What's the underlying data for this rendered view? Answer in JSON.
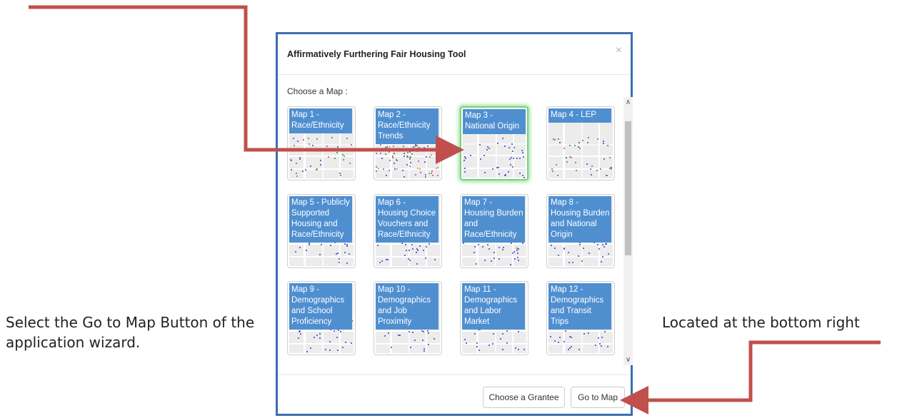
{
  "annotations": {
    "left": "Select the Go to Map Button of the application wizard.",
    "right": "Located at the bottom right"
  },
  "colors": {
    "modal_border": "#3b6fb0",
    "tile_label_bg": "#4f8fd0",
    "selected_glow": "#7cd17c",
    "arrow": "#c0504d"
  },
  "modal": {
    "title": "Affirmatively Furthering Fair Housing Tool",
    "close_icon": "close-icon",
    "close_label": "×",
    "choose_label": "Choose a Map :",
    "maps": [
      {
        "label": "Map 1 - Race/Ethnicity"
      },
      {
        "label": "Map 2 - Race/Ethnicity Trends"
      },
      {
        "label": "Map 3 - National Origin",
        "selected": true
      },
      {
        "label": "Map 4 - LEP"
      },
      {
        "label": "Map 5 - Publicly Supported Housing and Race/Ethnicity"
      },
      {
        "label": "Map 6 - Housing Choice Vouchers and Race/Ethnicity"
      },
      {
        "label": "Map 7 - Housing Burden and Race/Ethnicity"
      },
      {
        "label": "Map 8 - Housing Burden and National Origin"
      },
      {
        "label": "Map 9 - Demographics and School Proficiency"
      },
      {
        "label": "Map 10 - Demographics and Job Proximity"
      },
      {
        "label": "Map 11 - Demographics and Labor Market"
      },
      {
        "label": "Map 12 - Demographics and Transit Trips"
      }
    ],
    "scroll_up": "∧",
    "scroll_down": "∨",
    "footer": {
      "choose_grantee": "Choose a Grantee",
      "go_to_map": "Go to Map"
    }
  }
}
